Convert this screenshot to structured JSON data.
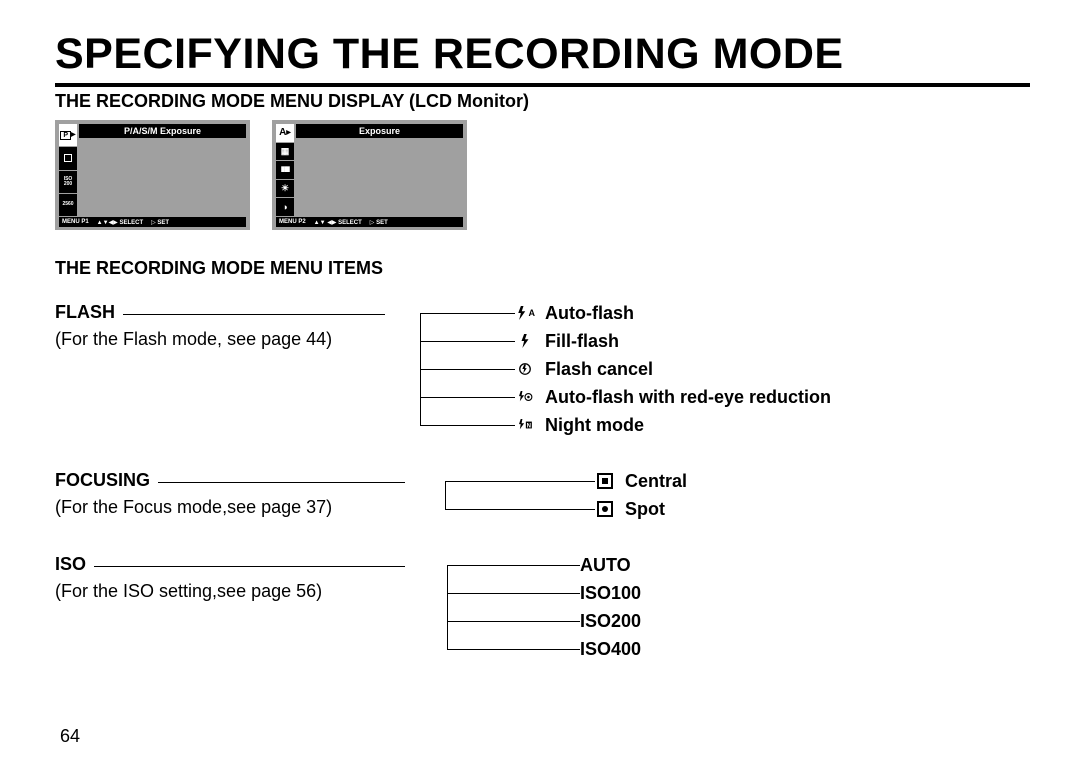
{
  "title": "SPECIFYING THE RECORDING MODE",
  "subtitle": "THE RECORDING MODE MENU DISPLAY (LCD Monitor)",
  "section2": "THE RECORDING MODE MENU ITEMS",
  "page_number": "64",
  "lcd1": {
    "header": "P/A/S/M Exposure",
    "side": [
      "P",
      "□",
      "ISO 200",
      "2560"
    ],
    "footer_menu": "MENU P1",
    "footer_select": "SELECT",
    "footer_set": "SET"
  },
  "lcd2": {
    "header": "Exposure",
    "side": [
      "A",
      "▦",
      "≡",
      "☀",
      "◑"
    ],
    "footer_menu": "MENU P2",
    "footer_select": "SELECT",
    "footer_set": "SET"
  },
  "flash": {
    "heading": "FLASH",
    "note": "(For the Flash mode, see page 44)",
    "options": [
      "Auto-flash",
      "Fill-flash",
      "Flash cancel",
      "Auto-flash with red-eye reduction",
      "Night mode"
    ]
  },
  "focusing": {
    "heading": "FOCUSING",
    "note": "(For the Focus mode,see page 37)",
    "options": [
      "Central",
      "Spot"
    ]
  },
  "iso": {
    "heading": "ISO",
    "note": "(For the ISO setting,see page 56)",
    "options": [
      "AUTO",
      "ISO100",
      "ISO200",
      "ISO400"
    ]
  }
}
